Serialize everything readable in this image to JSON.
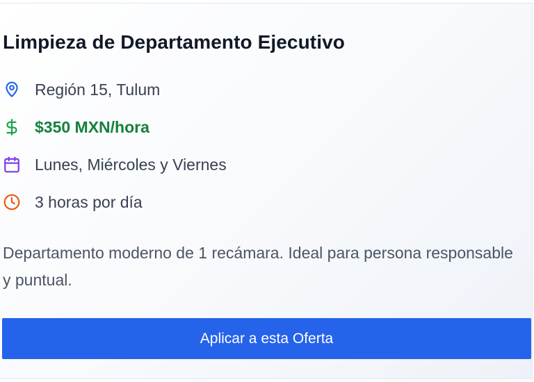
{
  "job": {
    "title": "Limpieza de Departamento Ejecutivo",
    "details": {
      "location": {
        "icon": "map-pin-icon",
        "text": "Región 15, Tulum",
        "color": "#2563eb"
      },
      "price": {
        "icon": "dollar-icon",
        "text": "$350 MXN/hora",
        "color": "#16a34a"
      },
      "schedule": {
        "icon": "calendar-icon",
        "text": "Lunes, Miércoles y Viernes",
        "color": "#7c3aed"
      },
      "duration": {
        "icon": "clock-icon",
        "text": "3 horas por día",
        "color": "#ea580c"
      }
    },
    "description": "Departamento moderno de 1 recámara. Ideal para persona responsable y puntual.",
    "apply_label": "Aplicar a esta Oferta"
  },
  "colors": {
    "accent": "#2563eb",
    "price_text": "#15803d",
    "title_text": "#111827",
    "body_text": "#374151"
  }
}
